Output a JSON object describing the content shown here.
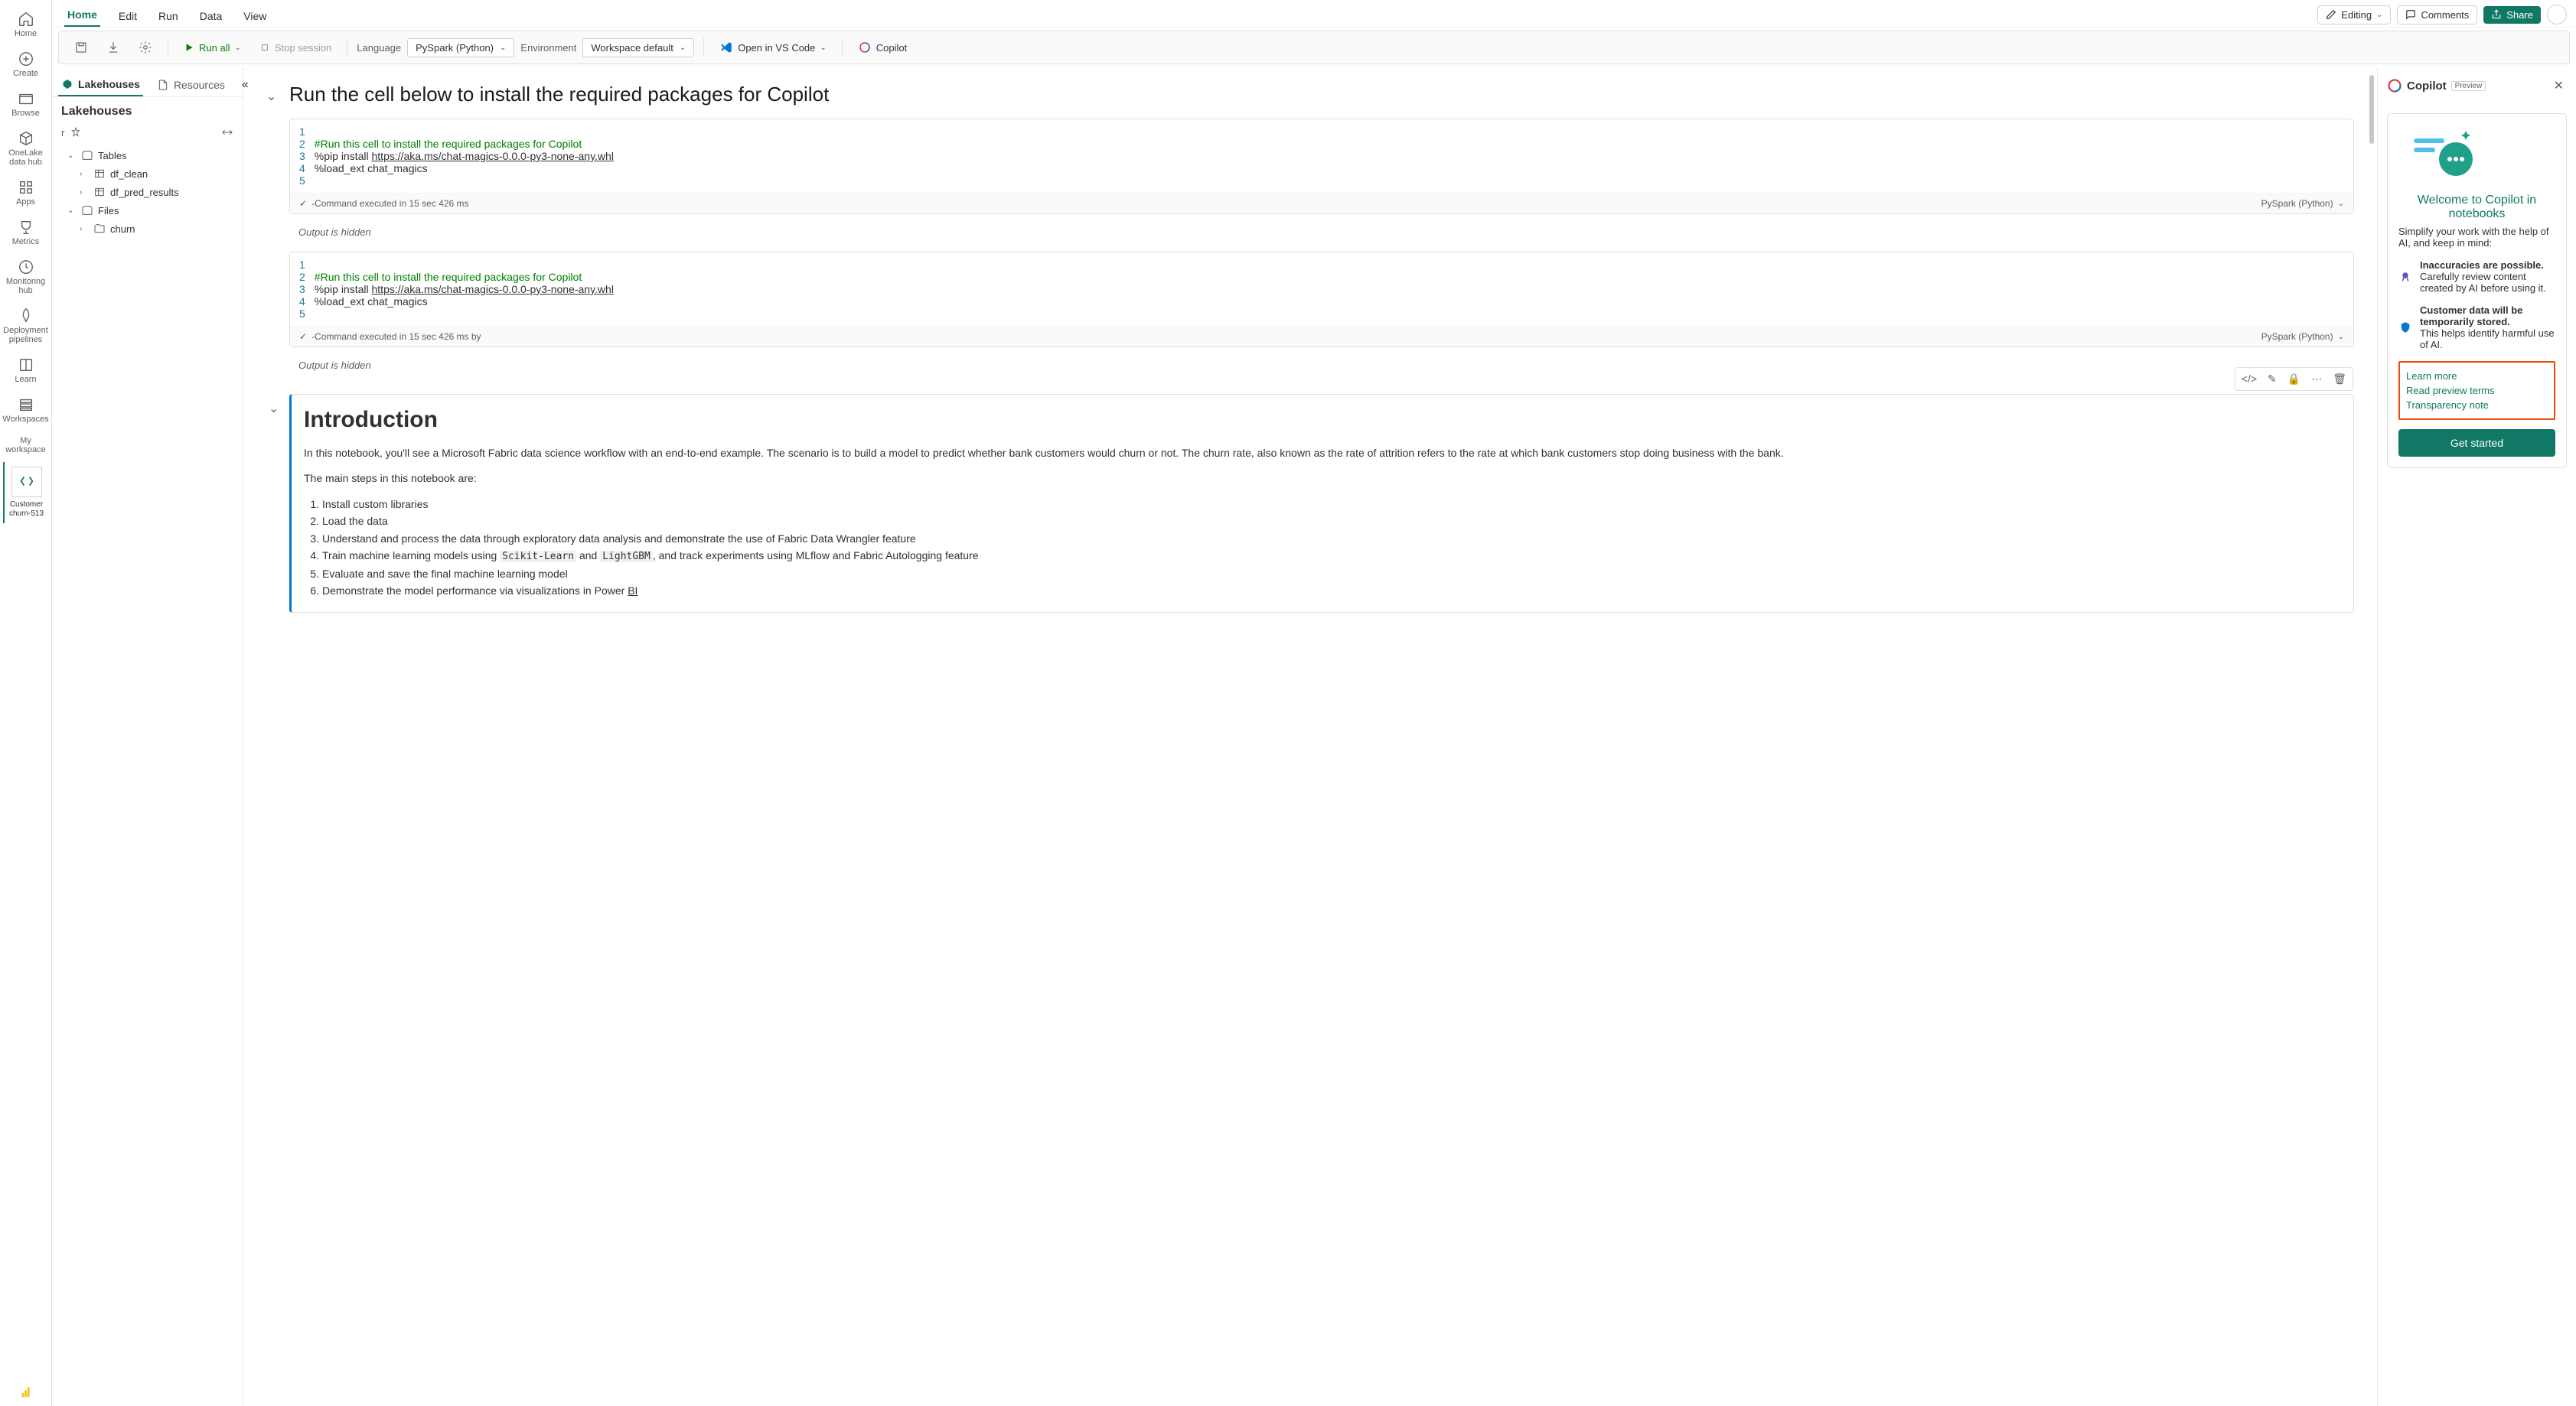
{
  "rail": {
    "items": [
      {
        "label": "Home",
        "icon": "home"
      },
      {
        "label": "Create",
        "icon": "plus"
      },
      {
        "label": "Browse",
        "icon": "folder"
      },
      {
        "label": "OneLake data hub",
        "icon": "cube"
      },
      {
        "label": "Apps",
        "icon": "grid"
      },
      {
        "label": "Metrics",
        "icon": "trophy"
      },
      {
        "label": "Monitoring hub",
        "icon": "pulse"
      },
      {
        "label": "Deployment pipelines",
        "icon": "rocket"
      },
      {
        "label": "Learn",
        "icon": "book"
      },
      {
        "label": "Workspaces",
        "icon": "stack"
      },
      {
        "label": "My workspace",
        "icon": "person"
      }
    ],
    "thumb": "Customer churn-513"
  },
  "menu": [
    "Home",
    "Edit",
    "Run",
    "Data",
    "View"
  ],
  "top_right": {
    "editing": "Editing",
    "comments": "Comments",
    "share": "Share"
  },
  "toolbar": {
    "run_all": "Run all",
    "stop": "Stop session",
    "language_label": "Language",
    "language_value": "PySpark (Python)",
    "env_label": "Environment",
    "env_value": "Workspace default",
    "vscode": "Open in VS Code",
    "copilot": "Copilot"
  },
  "explorer": {
    "tabs": [
      "Lakehouses",
      "Resources"
    ],
    "title": "Lakehouses",
    "current": "r",
    "tree": {
      "tables": "Tables",
      "tbl1": "df_clean",
      "tbl2": "df_pred_results",
      "files": "Files",
      "folder1": "churn"
    }
  },
  "notebook": {
    "section1_title": "Run the cell below to install the required packages for Copilot",
    "cell1": {
      "lines": [
        "#Run this cell to install the required packages for Copilot",
        "%pip install ",
        "https://aka.ms/chat-magics-0.0.0-py3-none-any.whl",
        "%load_ext chat_magics"
      ],
      "status": "-Command executed in 15 sec 426 ms",
      "lang": "PySpark (Python)",
      "output": "Output is hidden"
    },
    "cell2": {
      "status": "-Command executed in 15 sec 426 ms by",
      "lang": "PySpark (Python)",
      "output": "Output is hidden"
    },
    "intro": {
      "title": "Introduction",
      "p1": "In this notebook, you'll see a Microsoft Fabric data science workflow with an end-to-end example. The scenario is to build a model to predict whether bank customers would churn or not. The churn rate, also known as the rate of attrition refers to the rate at which bank customers stop doing business with the bank.",
      "p2": "The main steps in this notebook are:",
      "steps": [
        "Install custom libraries",
        "Load the data",
        "Understand and process the data through exploratory data analysis and demonstrate the use of Fabric Data Wrangler feature",
        "Train machine learning models using Scikit-Learn and LightGBM, and track experiments using MLflow and Fabric Autologging feature",
        "Evaluate and save the final machine learning model",
        "Demonstrate the model performance via visualizations in Power BI"
      ]
    }
  },
  "copilot": {
    "title": "Copilot",
    "preview": "Preview",
    "hero_title": "Welcome to Copilot in notebooks",
    "hero_sub": "Simplify your work with the help of AI, and keep in mind:",
    "point1_title": "Inaccuracies are possible.",
    "point1_body": "Carefully review content created by AI before using it.",
    "point2_title": "Customer data will be temporarily stored.",
    "point2_body": "This helps identify harmful use of AI.",
    "links": [
      "Learn more",
      "Read preview terms",
      "Transparency note"
    ],
    "button": "Get started"
  }
}
